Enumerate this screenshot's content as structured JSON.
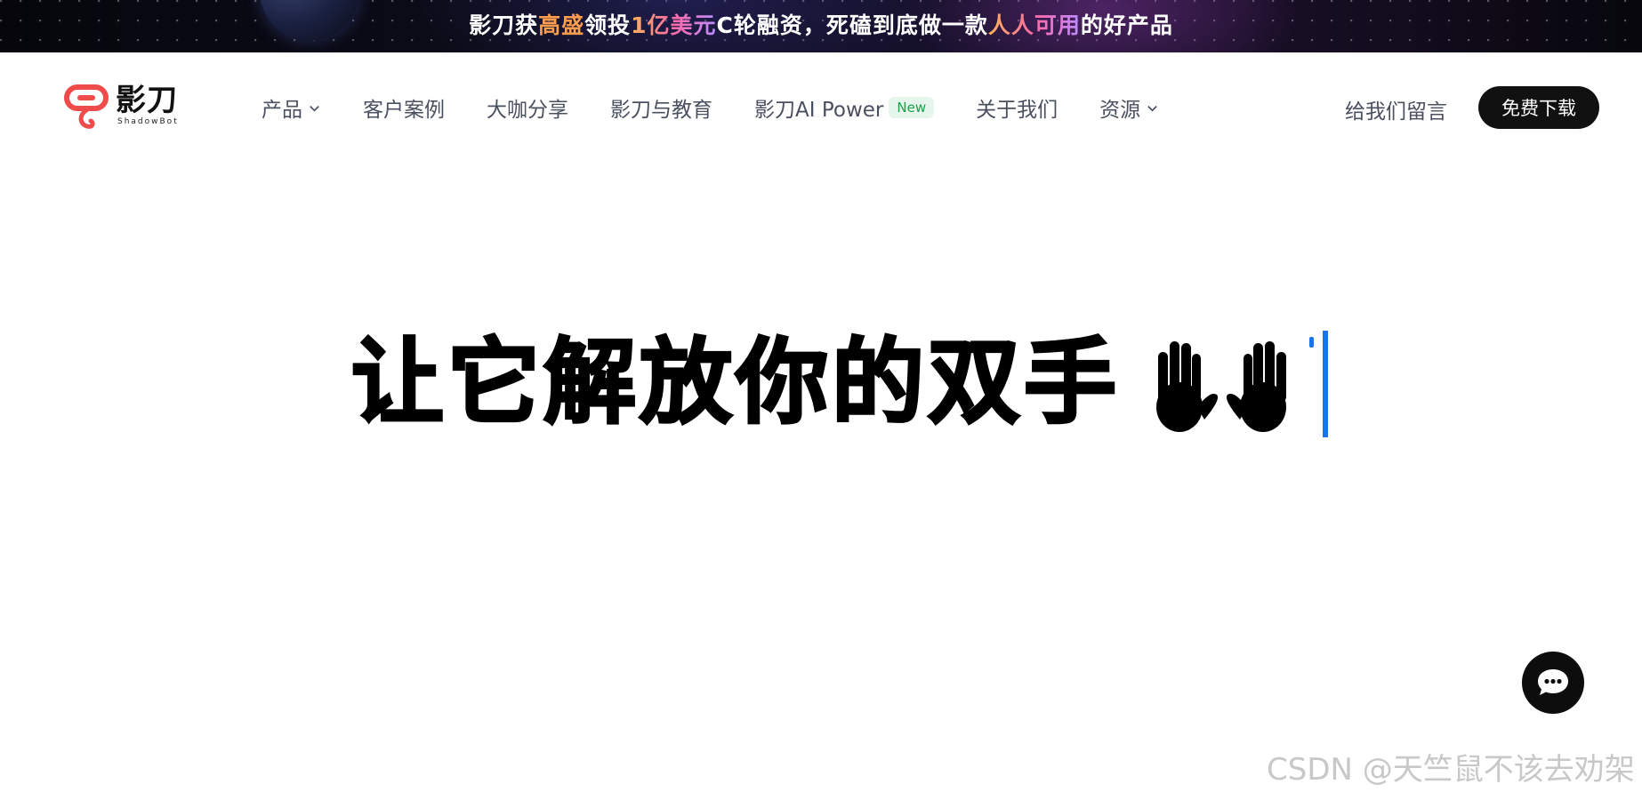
{
  "banner": {
    "t1": "影刀获",
    "t2": "高盛",
    "t3": "领投",
    "t4": "1亿美元",
    "t5": "C轮融资，死磕到底做一款",
    "t6": "人人可用",
    "t7": "的好产品"
  },
  "logo": {
    "name": "影刀",
    "sub": "ShadowBot"
  },
  "nav": {
    "items": [
      {
        "label": "产品",
        "has_dropdown": true
      },
      {
        "label": "客户案例"
      },
      {
        "label": "大咖分享"
      },
      {
        "label": "影刀与教育"
      },
      {
        "label": "影刀AI Power",
        "badge": "New"
      },
      {
        "label": "关于我们"
      },
      {
        "label": "资源",
        "has_dropdown": true
      }
    ],
    "contact": "给我们留言",
    "download": "免费下载"
  },
  "hero": {
    "title": "让它解放你的双手",
    "emoji": "hands-icon"
  },
  "chat": {
    "icon": "chat-icon"
  },
  "watermark": "CSDN @天竺鼠不该去劝架",
  "colors": {
    "accent_caret": "#1a73e8",
    "badge_green": "#16a34a",
    "download_bg": "#111111"
  }
}
